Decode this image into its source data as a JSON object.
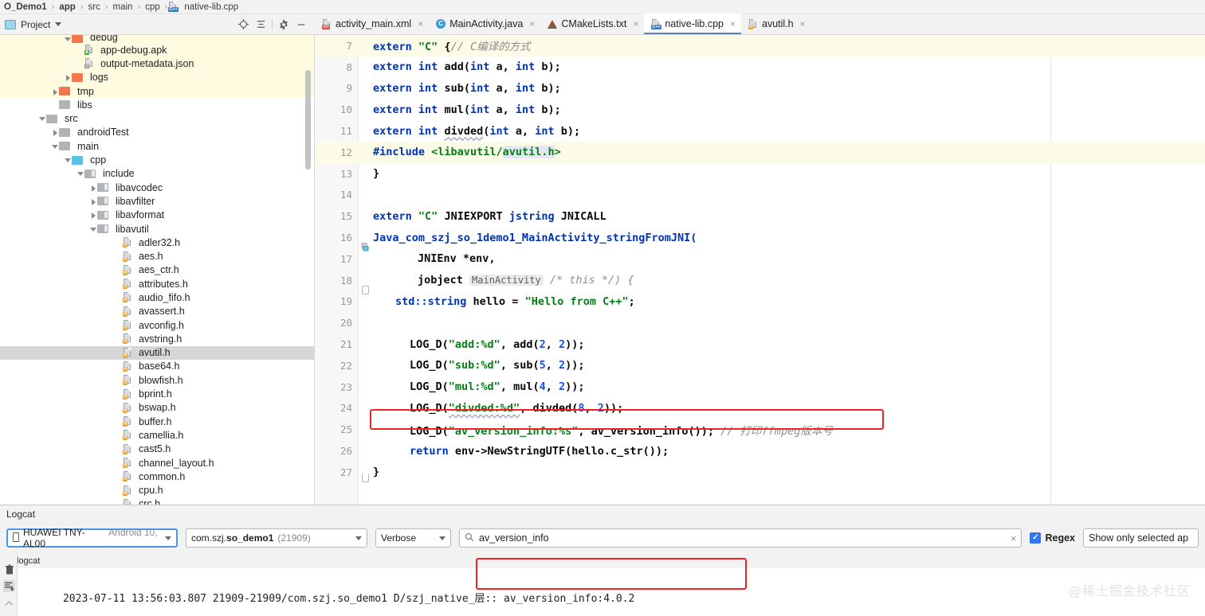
{
  "breadcrumb": {
    "items": [
      {
        "label": "O_Demo1",
        "bold": true,
        "icon": null
      },
      {
        "label": "app",
        "bold": true,
        "icon": null
      },
      {
        "label": "src",
        "bold": false,
        "icon": null
      },
      {
        "label": "main",
        "bold": false,
        "icon": null
      },
      {
        "label": "cpp",
        "bold": false,
        "icon": null
      },
      {
        "label": "native-lib.cpp",
        "bold": false,
        "icon": "cpp-file-icon"
      }
    ],
    "separator": "›"
  },
  "project_panel": {
    "title": "Project",
    "dropdown_caret": "▾",
    "toolbar_icons": [
      "locate-icon",
      "collapse-all-icon",
      "settings-gear-icon",
      "minimize-icon"
    ]
  },
  "tree": [
    {
      "label": "debug",
      "indent": 5,
      "type": "folder-orange",
      "arrow": "down",
      "hl": "yellow",
      "clipped": true
    },
    {
      "label": "app-debug.apk",
      "indent": 6,
      "type": "apk",
      "arrow": "none",
      "hl": "yellow"
    },
    {
      "label": "output-metadata.json",
      "indent": 6,
      "type": "json",
      "arrow": "none",
      "hl": "yellow"
    },
    {
      "label": "logs",
      "indent": 5,
      "type": "folder-orange",
      "arrow": "right",
      "hl": "yellow"
    },
    {
      "label": "tmp",
      "indent": 4,
      "type": "folder-orange",
      "arrow": "right",
      "hl": "yellow"
    },
    {
      "label": "libs",
      "indent": 4,
      "type": "folder-gray",
      "arrow": "none",
      "hl": "none"
    },
    {
      "label": "src",
      "indent": 3,
      "type": "folder-gray",
      "arrow": "down",
      "hl": "none"
    },
    {
      "label": "androidTest",
      "indent": 4,
      "type": "folder-gray",
      "arrow": "right",
      "hl": "none"
    },
    {
      "label": "main",
      "indent": 4,
      "type": "folder-gray",
      "arrow": "down",
      "hl": "none"
    },
    {
      "label": "cpp",
      "indent": 5,
      "type": "folder-blue",
      "arrow": "down",
      "hl": "none"
    },
    {
      "label": "include",
      "indent": 6,
      "type": "folder-lib",
      "arrow": "down",
      "hl": "none"
    },
    {
      "label": "libavcodec",
      "indent": 7,
      "type": "folder-lib",
      "arrow": "right",
      "hl": "none"
    },
    {
      "label": "libavfilter",
      "indent": 7,
      "type": "folder-lib",
      "arrow": "right",
      "hl": "none"
    },
    {
      "label": "libavformat",
      "indent": 7,
      "type": "folder-lib",
      "arrow": "right",
      "hl": "none"
    },
    {
      "label": "libavutil",
      "indent": 7,
      "type": "folder-lib",
      "arrow": "down",
      "hl": "none"
    },
    {
      "label": "adler32.h",
      "indent": 9,
      "type": "h-file",
      "arrow": "none",
      "hl": "none"
    },
    {
      "label": "aes.h",
      "indent": 9,
      "type": "h-file",
      "arrow": "none",
      "hl": "none"
    },
    {
      "label": "aes_ctr.h",
      "indent": 9,
      "type": "h-file",
      "arrow": "none",
      "hl": "none"
    },
    {
      "label": "attributes.h",
      "indent": 9,
      "type": "h-file",
      "arrow": "none",
      "hl": "none"
    },
    {
      "label": "audio_fifo.h",
      "indent": 9,
      "type": "h-file",
      "arrow": "none",
      "hl": "none"
    },
    {
      "label": "avassert.h",
      "indent": 9,
      "type": "h-file",
      "arrow": "none",
      "hl": "none"
    },
    {
      "label": "avconfig.h",
      "indent": 9,
      "type": "h-file",
      "arrow": "none",
      "hl": "none"
    },
    {
      "label": "avstring.h",
      "indent": 9,
      "type": "h-file",
      "arrow": "none",
      "hl": "none"
    },
    {
      "label": "avutil.h",
      "indent": 9,
      "type": "h-file",
      "arrow": "none",
      "hl": "selected"
    },
    {
      "label": "base64.h",
      "indent": 9,
      "type": "h-file",
      "arrow": "none",
      "hl": "none"
    },
    {
      "label": "blowfish.h",
      "indent": 9,
      "type": "h-file",
      "arrow": "none",
      "hl": "none"
    },
    {
      "label": "bprint.h",
      "indent": 9,
      "type": "h-file",
      "arrow": "none",
      "hl": "none"
    },
    {
      "label": "bswap.h",
      "indent": 9,
      "type": "h-file",
      "arrow": "none",
      "hl": "none"
    },
    {
      "label": "buffer.h",
      "indent": 9,
      "type": "h-file",
      "arrow": "none",
      "hl": "none"
    },
    {
      "label": "camellia.h",
      "indent": 9,
      "type": "h-file",
      "arrow": "none",
      "hl": "none"
    },
    {
      "label": "cast5.h",
      "indent": 9,
      "type": "h-file",
      "arrow": "none",
      "hl": "none"
    },
    {
      "label": "channel_layout.h",
      "indent": 9,
      "type": "h-file",
      "arrow": "none",
      "hl": "none"
    },
    {
      "label": "common.h",
      "indent": 9,
      "type": "h-file",
      "arrow": "none",
      "hl": "none"
    },
    {
      "label": "cpu.h",
      "indent": 9,
      "type": "h-file",
      "arrow": "none",
      "hl": "none"
    },
    {
      "label": "crc.h",
      "indent": 9,
      "type": "h-file",
      "arrow": "none",
      "hl": "none"
    }
  ],
  "tabs": [
    {
      "label": "activity_main.xml",
      "icon": "xml-file-icon",
      "active": false,
      "close": "×"
    },
    {
      "label": "MainActivity.java",
      "icon": "java-file-icon",
      "active": false,
      "close": "×"
    },
    {
      "label": "CMakeLists.txt",
      "icon": "cmake-file-icon",
      "active": false,
      "close": "×"
    },
    {
      "label": "native-lib.cpp",
      "icon": "cpp-file-icon",
      "active": true,
      "close": "×"
    },
    {
      "label": "avutil.h",
      "icon": "h-file-icon",
      "active": false,
      "close": "×"
    }
  ],
  "editor": {
    "lines": [
      {
        "num": "7",
        "hl": true,
        "mark": null
      },
      {
        "num": "8",
        "hl": false,
        "mark": null
      },
      {
        "num": "9",
        "hl": false,
        "mark": null
      },
      {
        "num": "10",
        "hl": false,
        "mark": null
      },
      {
        "num": "11",
        "hl": false,
        "mark": null
      },
      {
        "num": "12",
        "hl": true,
        "mark": null
      },
      {
        "num": "13",
        "hl": false,
        "mark": null
      },
      {
        "num": "14",
        "hl": false,
        "mark": null
      },
      {
        "num": "15",
        "hl": false,
        "mark": null
      },
      {
        "num": "16",
        "hl": false,
        "mark": "jni"
      },
      {
        "num": "17",
        "hl": false,
        "mark": null
      },
      {
        "num": "18",
        "hl": false,
        "mark": "fold"
      },
      {
        "num": "19",
        "hl": false,
        "mark": null
      },
      {
        "num": "20",
        "hl": false,
        "mark": null
      },
      {
        "num": "21",
        "hl": false,
        "mark": null
      },
      {
        "num": "22",
        "hl": false,
        "mark": null
      },
      {
        "num": "23",
        "hl": false,
        "mark": null
      },
      {
        "num": "24",
        "hl": false,
        "mark": null
      },
      {
        "num": "25",
        "hl": false,
        "mark": null
      },
      {
        "num": "26",
        "hl": false,
        "mark": null
      },
      {
        "num": "27",
        "hl": false,
        "mark": "foldend"
      }
    ],
    "text": {
      "l7_kw": "extern",
      "l7_str": "\"C\"",
      "l7_brace": "{",
      "l7_cmt": "// C编译的方式",
      "l8": "add",
      "l9": "sub",
      "l10": "mul",
      "l11": "divded",
      "l12_inc": "#include",
      "l12_path_a": "<libavutil/",
      "l12_path_b": "avutil.h",
      "l12_path_c": ">",
      "l13": "}",
      "l15": "extern \"C\" JNIEXPORT jstring JNICALL",
      "l16": "Java_com_szj_so_1demo1_MainActivity_stringFromJNI(",
      "l17": "JNIEnv *env,",
      "l18_a": "jobject",
      "l18_hint": "MainActivity",
      "l18_b": "/* this */) {",
      "l19": "std::string hello = \"Hello from C++\";",
      "l21": "LOG_D(\"add:%d\", add(2, 2));",
      "l22": "LOG_D(\"sub:%d\", sub(5, 2));",
      "l23": "LOG_D(\"mul:%d\", mul(4, 2));",
      "l24": "LOG_D(\"divded:%d\", divded(8, 2));",
      "l25": "LOG_D(\"av_version_info:%s\", av_version_info());",
      "l25_cmt": "// 打印ffmpeg版本号",
      "l26": "return env->NewStringUTF(hello.c_str());",
      "l27": "}"
    },
    "highlight_box_color": "#ee2222"
  },
  "logcat": {
    "panel_title": "Logcat",
    "device": {
      "name": "HUAWEI TNY-AL00",
      "detail": "Android 10, ,",
      "icon": "phone-icon"
    },
    "process": {
      "package_prefix": "com.szj.",
      "package_bold": "so_demo1",
      "pid": "(21909)"
    },
    "level": "Verbose",
    "search": {
      "value": "av_version_info",
      "icon": "search-icon",
      "clear": "×"
    },
    "regex": {
      "label": "Regex",
      "checked": true,
      "check_glyph": "✓"
    },
    "show_selected": "Show only selected ap",
    "tag_row": "logcat",
    "side_icons": [
      "trash-icon",
      "scroll-to-end-icon",
      "up-arrow-icon"
    ],
    "output_line": {
      "prefix": "2023-07-11 13:56:03.807 21909-21909/com.szj.so_demo1 D/szj_native_",
      "highlighted": "层:: av_version_info:4.0.2"
    },
    "highlight_box_color": "#ee2222"
  },
  "watermark": "@稀土掘金技术社区"
}
